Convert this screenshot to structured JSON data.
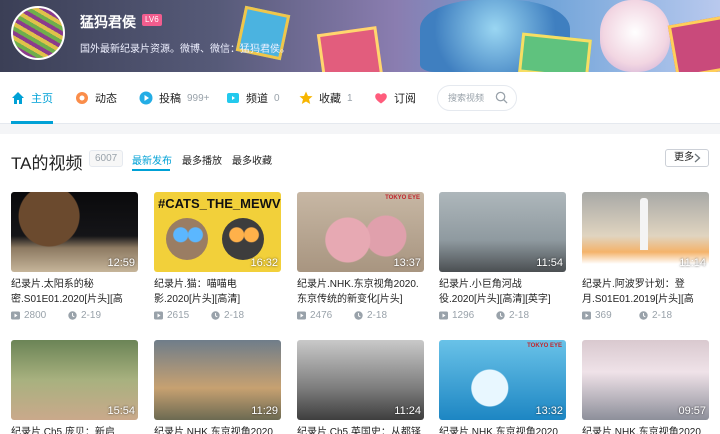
{
  "profile": {
    "name": "猛犸君侯",
    "level": "LV6",
    "sign": "国外最新纪录片资源。微博、微信：猛犸君侯。"
  },
  "nav": {
    "home": "主页",
    "dynamic": "动态",
    "contribute": "投稿",
    "contribute_count": "999+",
    "channel": "频道",
    "channel_count": "0",
    "favorites": "收藏",
    "favorites_count": "1",
    "subscribe": "订阅",
    "search_placeholder": "搜索视频"
  },
  "section": {
    "title": "TA的视频",
    "count": "6007",
    "tabs": [
      "最新发布",
      "最多播放",
      "最多收藏"
    ],
    "more": "更多"
  },
  "colors": {
    "accent": "#00a1d6",
    "level_badge": "#f25d8e",
    "muted": "#99a2aa"
  },
  "videos": [
    {
      "title": "纪录片.太阳系的秘密.S01E01.2020[片头][高",
      "duration": "12:59",
      "plays": "2800",
      "date": "2-19"
    },
    {
      "title": "纪录片.猫：喵喵电影.2020[片头][高清]",
      "duration": "16:32",
      "plays": "2615",
      "date": "2-18",
      "thumb_text": "#CATS_THE_MEWVIE"
    },
    {
      "title": "纪录片.NHK.东京视角2020.东京传统的新变化[片头]",
      "duration": "13:37",
      "plays": "2476",
      "date": "2-18",
      "thumb_text": "TOKYO EYE"
    },
    {
      "title": "纪录片.小巨角河战役.2020[片头][高清][英字]",
      "duration": "11:54",
      "plays": "1296",
      "date": "2-18"
    },
    {
      "title": "纪录片.阿波罗计划：登月.S01E01.2019[片头][高",
      "duration": "11:14",
      "plays": "369",
      "date": "2-18"
    },
    {
      "title": "纪录片.Ch5.庞贝：新启",
      "duration": "15:54"
    },
    {
      "title": "纪录片.NHK.东京视角2020",
      "duration": "11:29"
    },
    {
      "title": "纪录片.Ch5.英国史：从都铎",
      "duration": "11:24"
    },
    {
      "title": "纪录片.NHK.东京视角2020",
      "duration": "13:32",
      "thumb_text": "TOKYO EYE"
    },
    {
      "title": "纪录片.NHK.东京视角2020",
      "duration": "09:57"
    }
  ]
}
